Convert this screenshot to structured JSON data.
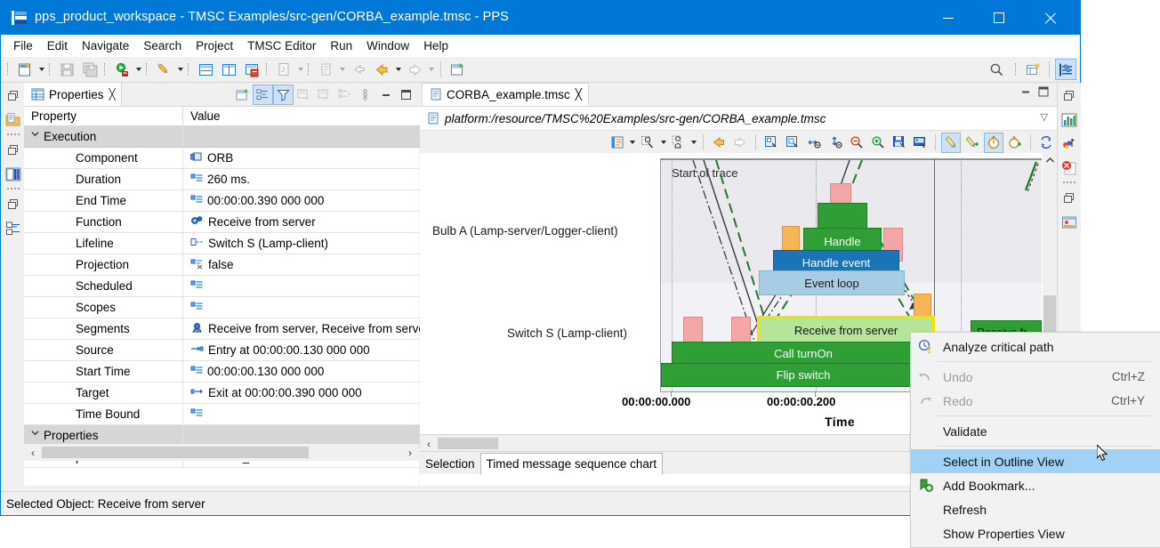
{
  "window": {
    "title": "pps_product_workspace - TMSC Examples/src-gen/CORBA_example.tmsc - PPS",
    "icon": "application-icon",
    "minimize": "minimize-button",
    "maximize": "maximize-button",
    "close": "close-button"
  },
  "menubar": {
    "items": [
      "File",
      "Edit",
      "Navigate",
      "Search",
      "Project",
      "TMSC Editor",
      "Run",
      "Window",
      "Help"
    ]
  },
  "toolbar": {
    "items": [
      {
        "name": "new-wizard-icon"
      },
      {
        "name": "save-icon"
      },
      {
        "name": "save-all-icon"
      },
      {
        "name": "run-icon"
      },
      {
        "name": "launch-icon"
      },
      {
        "name": "toggle-horizontal-layout-icon"
      },
      {
        "name": "toggle-vertical-layout-icon"
      },
      {
        "name": "restore-layout-icon"
      },
      {
        "name": "open-type-icon"
      },
      {
        "name": "next-annotation-icon"
      },
      {
        "name": "last-edit-location-icon"
      },
      {
        "name": "back-icon"
      },
      {
        "name": "forward-icon"
      },
      {
        "name": "new-editor-icon"
      },
      {
        "name": "search-icon"
      },
      {
        "name": "new-perspective-icon"
      },
      {
        "name": "tmsc-perspective-icon"
      }
    ]
  },
  "left_fast_view": {
    "items": [
      "minimize-restore-icon",
      "project-explorer-icon",
      "model-library-icon",
      "minimize-restore-icon-2",
      "outline-view-icon"
    ]
  },
  "right_fast_view": {
    "items": [
      "minimize-restore-icon",
      "chart-view-icon",
      "metrics-view-icon",
      "problems-view-icon",
      "minimize-restore-icon-2",
      "console-view-icon"
    ]
  },
  "properties_view": {
    "tab_label": "Properties",
    "close_glyph": "╳",
    "toolbar": [
      {
        "name": "new-view-icon",
        "active": false
      },
      {
        "name": "show-categories-icon",
        "active": true
      },
      {
        "name": "filter-icon",
        "active": true
      },
      {
        "name": "pin-to-selection-icon",
        "active": false
      },
      {
        "name": "restore-default-icon",
        "active": false
      },
      {
        "name": "show-advanced-icon",
        "active": false
      },
      {
        "name": "view-menu-icon",
        "active": false
      },
      {
        "name": "minimize-icon",
        "active": false
      },
      {
        "name": "maximize-icon",
        "active": false
      }
    ],
    "columns": [
      "Property",
      "Value"
    ],
    "rows": [
      {
        "type": "group",
        "name": "Execution",
        "value": "",
        "icon": ""
      },
      {
        "type": "item",
        "name": "Component",
        "value": "ORB",
        "icon": "component-icon"
      },
      {
        "type": "item",
        "name": "Duration",
        "value": "260 ms.",
        "icon": "text-value-icon"
      },
      {
        "type": "item",
        "name": "End Time",
        "value": "00:00:00.390 000 000",
        "icon": "text-value-icon"
      },
      {
        "type": "item",
        "name": "Function",
        "value": "Receive from server",
        "icon": "function-icon"
      },
      {
        "type": "item",
        "name": "Lifeline",
        "value": "Switch S (Lamp-client)",
        "icon": "lifeline-icon"
      },
      {
        "type": "item",
        "name": "Projection",
        "value": "false",
        "icon": "projection-icon"
      },
      {
        "type": "item",
        "name": "Scheduled",
        "value": "",
        "icon": "text-value-icon"
      },
      {
        "type": "item",
        "name": "Scopes",
        "value": "",
        "icon": "text-value-icon"
      },
      {
        "type": "item",
        "name": "Segments",
        "value": "Receive from server, Receive from server",
        "icon": "segments-icon"
      },
      {
        "type": "item",
        "name": "Source",
        "value": "Entry at 00:00:00.130 000 000",
        "icon": "source-entry-icon"
      },
      {
        "type": "item",
        "name": "Start Time",
        "value": "00:00:00.130 000 000",
        "icon": "text-value-icon"
      },
      {
        "type": "item",
        "name": "Target",
        "value": "Exit at 00:00:00.390 000 000",
        "icon": "target-exit-icon"
      },
      {
        "type": "item",
        "name": "Time Bound",
        "value": "",
        "icon": "text-value-icon"
      },
      {
        "type": "group",
        "name": "Properties",
        "value": "",
        "icon": ""
      },
      {
        "type": "item",
        "name": "paint",
        "value": "LIGHT_GREEN",
        "icon": "text-value-icon"
      }
    ],
    "scroll_left_glyph": "‹",
    "scroll_right_glyph": "›"
  },
  "status_bar": {
    "text": "Selected Object: Receive from server"
  },
  "editor": {
    "tab_label": "CORBA_example.tmsc",
    "tab_icon": "tmsc-file-icon",
    "close_glyph": "╳",
    "minimize": "minimize-icon",
    "maximize": "maximize-icon",
    "path": "platform:/resource/TMSC%20Examples/src-gen/CORBA_example.tmsc",
    "path_icon": "tmsc-file-icon",
    "path_collapse_glyph": "▽",
    "toolbar": [
      {
        "name": "show-view-options-icon",
        "active": false,
        "caret": true
      },
      {
        "name": "highlight-options-icon",
        "active": false,
        "caret": true
      },
      {
        "name": "lifeline-options-icon",
        "active": false,
        "caret": true
      },
      {
        "name": "previous-icon",
        "active": false
      },
      {
        "name": "next-icon",
        "active": false
      },
      {
        "name": "zoom-selection-icon",
        "active": false
      },
      {
        "name": "zoom-fit-icon",
        "active": false
      },
      {
        "name": "zoom-out-horizontal-icon",
        "active": false
      },
      {
        "name": "zoom-in-vertical-icon",
        "active": false
      },
      {
        "name": "zoom-out-icon",
        "active": false
      },
      {
        "name": "zoom-in-icon",
        "active": false
      },
      {
        "name": "save-image-icon",
        "active": false
      },
      {
        "name": "export-image-icon",
        "active": false
      },
      {
        "name": "show-messages-icon",
        "active": true
      },
      {
        "name": "show-message-labels-icon",
        "active": false
      },
      {
        "name": "show-timing-icon",
        "active": true
      },
      {
        "name": "show-durations-icon",
        "active": false
      },
      {
        "name": "refresh-icon",
        "active": false
      }
    ],
    "scroll_left_glyph": "‹",
    "selection_tabs": [
      {
        "label": "Selection",
        "active": false
      },
      {
        "label": "Timed message sequence chart",
        "active": true
      }
    ]
  },
  "chart_data": {
    "type": "gantt",
    "title": "",
    "xlabel": "Time",
    "ylabel": "",
    "annotation": "Start of trace",
    "lifelines": [
      {
        "label": "Bulb A (Lamp-server/Logger-client)"
      },
      {
        "label": "Switch S (Lamp-client)"
      }
    ],
    "xticks": [
      "00:00:00.000",
      "00:00:00.200"
    ],
    "xlim": [
      "00:00:00.000",
      "00:00:00.400"
    ],
    "executions": [
      {
        "label": "Handle",
        "lifeline": "Bulb A (Lamp-server/Logger-client)",
        "color": "#2f9e35",
        "nested_level": 3
      },
      {
        "label": "Handle event",
        "lifeline": "Bulb A (Lamp-server/Logger-client)",
        "color": "#1a74b5",
        "nested_level": 2
      },
      {
        "label": "Event loop",
        "lifeline": "Bulb A (Lamp-server/Logger-client)",
        "color": "#a6cde4",
        "nested_level": 1
      },
      {
        "label": "Receive from server",
        "lifeline": "Switch S (Lamp-client)",
        "color": "#b6e59a",
        "selected": true,
        "nested_level": 3
      },
      {
        "label": "Call turnOn",
        "lifeline": "Switch S (Lamp-client)",
        "color": "#2f9e35",
        "nested_level": 2
      },
      {
        "label": "Flip switch",
        "lifeline": "Switch S (Lamp-client)",
        "color": "#2f9e35",
        "nested_level": 1
      },
      {
        "label": "Receive fr...",
        "lifeline": "Switch S (Lamp-client)",
        "color": "#b6e59a",
        "nested_level": 3
      }
    ],
    "legend_position": "none",
    "grid": true
  },
  "context_menu": {
    "items": [
      {
        "label": "Analyze critical path",
        "accel": "",
        "state": "normal",
        "icon": "analyze-critical-path-icon"
      },
      {
        "separator": true
      },
      {
        "label": "Undo",
        "accel": "Ctrl+Z",
        "state": "disabled",
        "icon": "undo-icon"
      },
      {
        "label": "Redo",
        "accel": "Ctrl+Y",
        "state": "disabled",
        "icon": "redo-icon"
      },
      {
        "separator": true
      },
      {
        "label": "Validate",
        "accel": "",
        "state": "normal",
        "icon": ""
      },
      {
        "separator": true
      },
      {
        "label": "Select in Outline View",
        "accel": "",
        "state": "highlighted",
        "icon": ""
      },
      {
        "label": "Add Bookmark...",
        "accel": "",
        "state": "normal",
        "icon": "add-bookmark-icon"
      },
      {
        "label": "Refresh",
        "accel": "",
        "state": "normal",
        "icon": ""
      },
      {
        "label": "Show Properties View",
        "accel": "",
        "state": "normal",
        "icon": ""
      }
    ]
  }
}
